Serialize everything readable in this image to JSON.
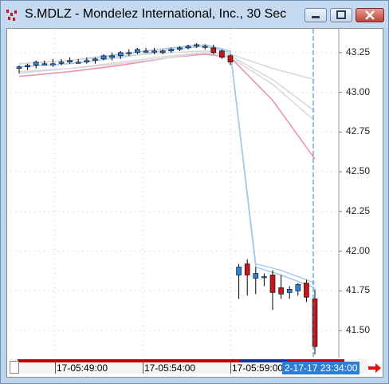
{
  "window": {
    "title": "S.MDLZ - Mondelez International, Inc., 30 Sec",
    "icon": "chart-app-icon",
    "controls": [
      "minimize",
      "maximize",
      "close"
    ]
  },
  "price_axis": {
    "labels": [
      "43.25",
      "43.00",
      "42.75",
      "42.50",
      "42.25",
      "42.00",
      "41.75",
      "41.50"
    ]
  },
  "time_axis": {
    "labels": [
      "17-05:49:00",
      "17-05:54:00",
      "17-05:59:00"
    ],
    "cursor_time": "2-17-17 23:34:00"
  },
  "colors": {
    "up_candle": "#2f7fd8",
    "down_candle": "#c4161c",
    "ma_blue": "#a8c8e8",
    "ma_pink": "#f08ab0",
    "ma_gray": "#d8d8d8",
    "cursor_line": "#2b7fd6"
  },
  "chart_data": {
    "type": "candlestick",
    "ylim": [
      41.33,
      43.4
    ],
    "y_ticks": [
      43.25,
      43.0,
      42.75,
      42.5,
      42.25,
      42.0,
      41.75,
      41.5
    ],
    "candles": [
      {
        "i": 0,
        "o": 43.15,
        "h": 43.17,
        "l": 43.12,
        "c": 43.16
      },
      {
        "i": 1,
        "o": 43.16,
        "h": 43.18,
        "l": 43.14,
        "c": 43.17
      },
      {
        "i": 2,
        "o": 43.17,
        "h": 43.2,
        "l": 43.15,
        "c": 43.19
      },
      {
        "i": 3,
        "o": 43.18,
        "h": 43.2,
        "l": 43.17,
        "c": 43.18
      },
      {
        "i": 4,
        "o": 43.18,
        "h": 43.21,
        "l": 43.16,
        "c": 43.18
      },
      {
        "i": 5,
        "o": 43.19,
        "h": 43.21,
        "l": 43.17,
        "c": 43.19
      },
      {
        "i": 6,
        "o": 43.19,
        "h": 43.22,
        "l": 43.18,
        "c": 43.2
      },
      {
        "i": 7,
        "o": 43.19,
        "h": 43.21,
        "l": 43.18,
        "c": 43.19
      },
      {
        "i": 8,
        "o": 43.19,
        "h": 43.22,
        "l": 43.18,
        "c": 43.2
      },
      {
        "i": 9,
        "o": 43.2,
        "h": 43.22,
        "l": 43.18,
        "c": 43.21
      },
      {
        "i": 10,
        "o": 43.21,
        "h": 43.24,
        "l": 43.2,
        "c": 43.23
      },
      {
        "i": 11,
        "o": 43.22,
        "h": 43.25,
        "l": 43.2,
        "c": 43.23
      },
      {
        "i": 12,
        "o": 43.23,
        "h": 43.26,
        "l": 43.21,
        "c": 43.25
      },
      {
        "i": 13,
        "o": 43.25,
        "h": 43.27,
        "l": 43.23,
        "c": 43.25
      },
      {
        "i": 14,
        "o": 43.25,
        "h": 43.28,
        "l": 43.24,
        "c": 43.27
      },
      {
        "i": 15,
        "o": 43.26,
        "h": 43.28,
        "l": 43.25,
        "c": 43.26
      },
      {
        "i": 16,
        "o": 43.26,
        "h": 43.28,
        "l": 43.24,
        "c": 43.26
      },
      {
        "i": 17,
        "o": 43.25,
        "h": 43.27,
        "l": 43.24,
        "c": 43.26
      },
      {
        "i": 18,
        "o": 43.26,
        "h": 43.28,
        "l": 43.25,
        "c": 43.27
      },
      {
        "i": 19,
        "o": 43.27,
        "h": 43.29,
        "l": 43.26,
        "c": 43.28
      },
      {
        "i": 20,
        "o": 43.28,
        "h": 43.3,
        "l": 43.27,
        "c": 43.29
      },
      {
        "i": 21,
        "o": 43.29,
        "h": 43.31,
        "l": 43.28,
        "c": 43.3
      },
      {
        "i": 22,
        "o": 43.29,
        "h": 43.3,
        "l": 43.27,
        "c": 43.29
      },
      {
        "i": 23,
        "o": 43.28,
        "h": 43.3,
        "l": 43.24,
        "c": 43.25
      },
      {
        "i": 24,
        "o": 43.26,
        "h": 43.27,
        "l": 43.21,
        "c": 43.22
      },
      {
        "i": 25,
        "o": 43.23,
        "h": 43.24,
        "l": 43.17,
        "c": 43.19
      },
      {
        "i": 26,
        "o": 41.85,
        "h": 41.92,
        "l": 41.7,
        "c": 41.9
      },
      {
        "i": 27,
        "o": 41.92,
        "h": 41.95,
        "l": 41.72,
        "c": 41.85
      },
      {
        "i": 28,
        "o": 41.83,
        "h": 41.9,
        "l": 41.73,
        "c": 41.86
      },
      {
        "i": 29,
        "o": 41.84,
        "h": 41.86,
        "l": 41.78,
        "c": 41.84
      },
      {
        "i": 30,
        "o": 41.85,
        "h": 41.88,
        "l": 41.63,
        "c": 41.74
      },
      {
        "i": 31,
        "o": 41.77,
        "h": 41.85,
        "l": 41.7,
        "c": 41.73
      },
      {
        "i": 32,
        "o": 41.74,
        "h": 41.78,
        "l": 41.7,
        "c": 41.76
      },
      {
        "i": 33,
        "o": 41.75,
        "h": 41.8,
        "l": 41.72,
        "c": 41.79
      },
      {
        "i": 34,
        "o": 41.8,
        "h": 41.82,
        "l": 41.68,
        "c": 41.71
      },
      {
        "i": 35,
        "o": 41.7,
        "h": 41.76,
        "l": 41.35,
        "c": 41.4
      }
    ],
    "moving_averages": [
      {
        "color": "blue",
        "points": [
          [
            0,
            43.18
          ],
          [
            6,
            43.2
          ],
          [
            12,
            43.24
          ],
          [
            18,
            43.28
          ],
          [
            22,
            43.3
          ],
          [
            25,
            43.26
          ],
          [
            28,
            41.92
          ],
          [
            31,
            41.88
          ],
          [
            35,
            41.8
          ]
        ]
      },
      {
        "color": "blue",
        "points": [
          [
            0,
            43.16
          ],
          [
            6,
            43.18
          ],
          [
            12,
            43.22
          ],
          [
            18,
            43.27
          ],
          [
            22,
            43.29
          ],
          [
            25,
            43.25
          ],
          [
            28,
            41.9
          ],
          [
            31,
            41.85
          ],
          [
            35,
            41.77
          ]
        ]
      },
      {
        "color": "pink",
        "points": [
          [
            0,
            43.1
          ],
          [
            6,
            43.13
          ],
          [
            12,
            43.17
          ],
          [
            18,
            43.22
          ],
          [
            22,
            43.24
          ],
          [
            25,
            43.22
          ],
          [
            30,
            42.95
          ],
          [
            35,
            42.58
          ]
        ]
      },
      {
        "color": "gray",
        "points": [
          [
            0,
            43.12
          ],
          [
            6,
            43.15
          ],
          [
            12,
            43.18
          ],
          [
            18,
            43.22
          ],
          [
            22,
            43.25
          ],
          [
            25,
            43.22
          ],
          [
            30,
            43.05
          ],
          [
            35,
            42.82
          ]
        ]
      },
      {
        "color": "gray",
        "points": [
          [
            0,
            43.13
          ],
          [
            6,
            43.15
          ],
          [
            12,
            43.19
          ],
          [
            18,
            43.23
          ],
          [
            22,
            43.25
          ],
          [
            25,
            43.23
          ],
          [
            30,
            43.08
          ],
          [
            35,
            42.88
          ]
        ]
      },
      {
        "color": "gray",
        "points": [
          [
            0,
            43.18
          ],
          [
            6,
            43.2
          ],
          [
            12,
            43.23
          ],
          [
            18,
            43.25
          ],
          [
            22,
            43.26
          ],
          [
            25,
            43.24
          ],
          [
            30,
            43.15
          ],
          [
            35,
            43.08
          ]
        ]
      }
    ]
  }
}
